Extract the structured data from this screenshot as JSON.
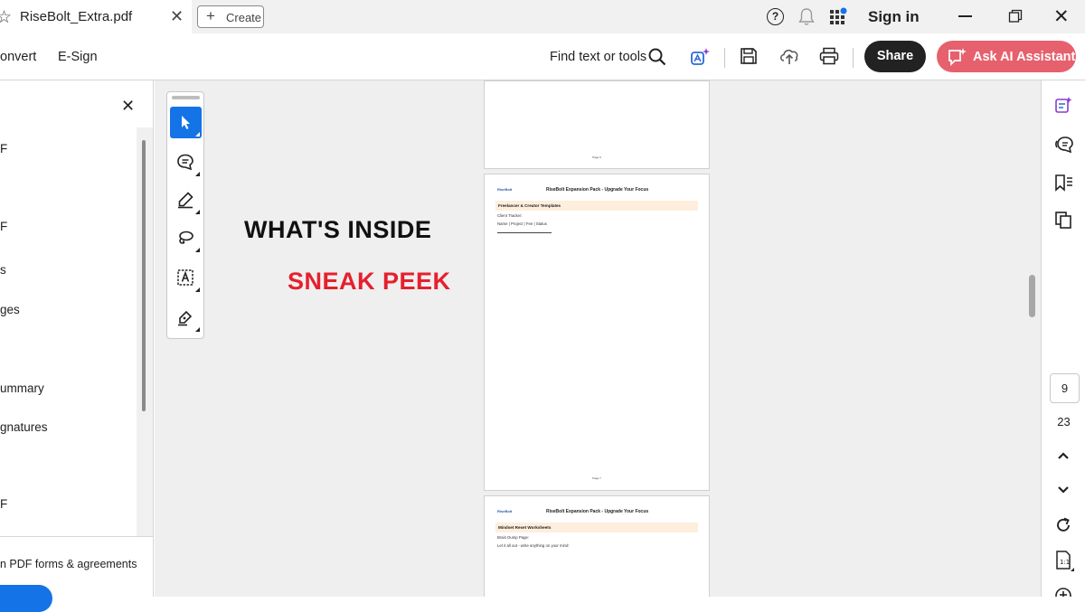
{
  "tab": {
    "title": "RiseBolt_Extra.pdf"
  },
  "create": {
    "label": "Create"
  },
  "header": {
    "signin": "Sign in"
  },
  "menu": {
    "convert": "onvert",
    "esign": "E-Sign"
  },
  "find": {
    "label": "Find text or tools"
  },
  "share": {
    "label": "Share"
  },
  "ai": {
    "label": "Ask AI Assistant"
  },
  "leftpanel": {
    "items": [
      "F",
      "F",
      "s",
      "ges",
      "ummary",
      "gnatures",
      "F"
    ],
    "footer": "n PDF forms & agreements"
  },
  "banner": {
    "title": "WHAT'S INSIDE",
    "subtitle": "SNEAK PEEK"
  },
  "pages": {
    "p6": {
      "num": "Page 6"
    },
    "p7": {
      "logo": "RiseBolt",
      "header": "RiseBolt Expansion Pack - Upgrade Your Focus",
      "section": "Freelancer & Creator Templates",
      "line1": "Client Tracker:",
      "line2": "Name | Project | Fee | Status",
      "num": "Page 7"
    },
    "p8": {
      "logo": "RiseBolt",
      "header": "RiseBolt Expansion Pack - Upgrade Your Focus",
      "section": "Mindset Reset Worksheets",
      "line1": "Brain Dump Page:",
      "line2": "Let it all out - write anything on your mind:"
    }
  },
  "pagenav": {
    "current": "9",
    "total": "23"
  },
  "colors": {
    "accent": "#1473e6",
    "ai": "#e6606d",
    "sneak": "#e5202e"
  },
  "icons": [
    "star-icon",
    "close-icon",
    "plus-icon",
    "help-icon",
    "bell-icon",
    "apps-icon",
    "search-icon",
    "ai-tools-icon",
    "save-icon",
    "upload-icon",
    "print-icon",
    "select-icon",
    "comment-icon",
    "highlight-icon",
    "lasso-icon",
    "text-box-icon",
    "sign-icon",
    "edit-pdf-icon",
    "comments-panel-icon",
    "bookmark-icon",
    "pages-icon",
    "refresh-icon",
    "fit-page-icon"
  ]
}
